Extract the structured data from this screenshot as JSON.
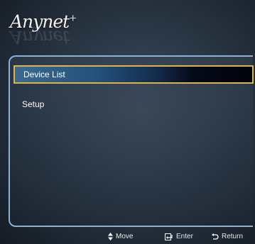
{
  "header": {
    "logo_text": "Anynet",
    "logo_sup": "+"
  },
  "menu": {
    "items": [
      {
        "label": "Device List",
        "selected": true
      },
      {
        "label": "Setup",
        "selected": false
      }
    ]
  },
  "footer": {
    "move": {
      "icon": "updown-arrow-icon",
      "label": "Move"
    },
    "enter": {
      "icon": "enter-icon",
      "label": "Enter"
    },
    "return": {
      "icon": "return-icon",
      "label": "Return"
    }
  },
  "colors": {
    "accent_border": "#e0b24a",
    "panel_border": "#8ab2d4"
  }
}
